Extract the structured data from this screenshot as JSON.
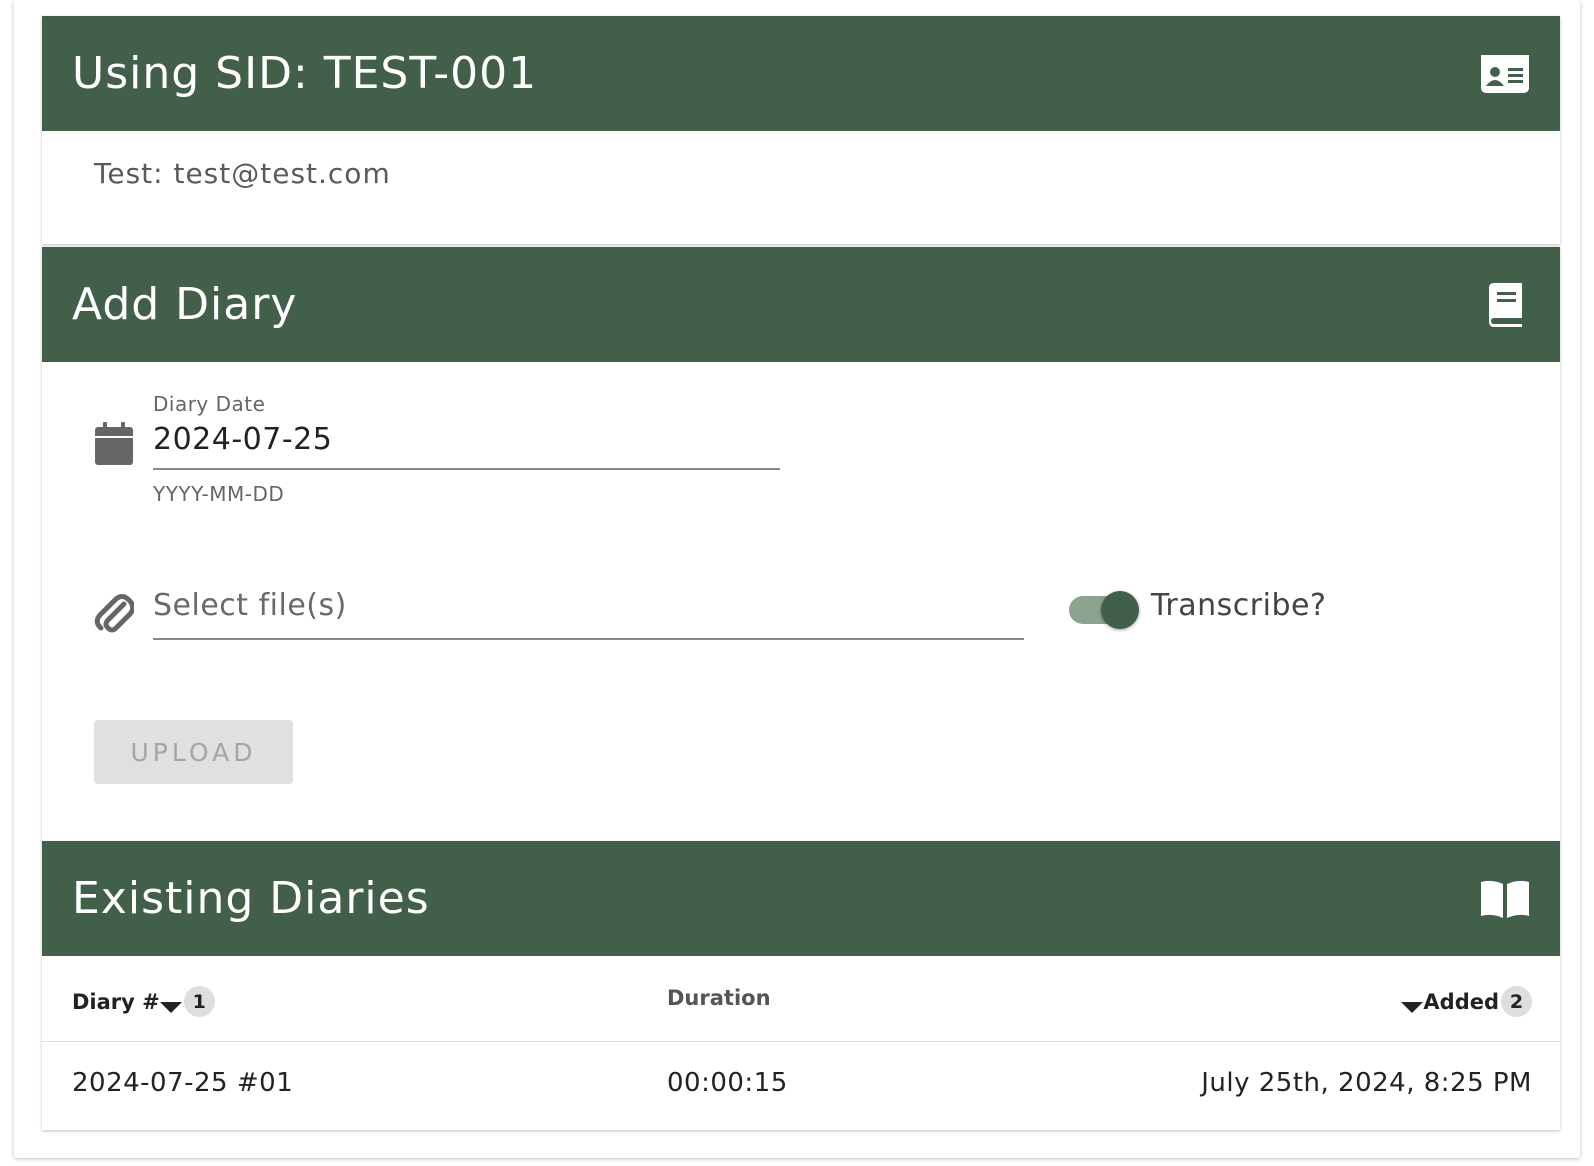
{
  "sid_card": {
    "title": "Using SID: TEST-001",
    "icon": "id-card-icon",
    "subject": "Test: test@test.com"
  },
  "add_diary": {
    "title": "Add Diary",
    "icon": "book-icon",
    "date_label": "Diary Date",
    "date_value": "2024-07-25",
    "date_hint": "YYYY-MM-DD",
    "file_placeholder": "Select file(s)",
    "transcribe_label": "Transcribe?",
    "transcribe_on": true,
    "upload_label": "UPLOAD"
  },
  "existing": {
    "title": "Existing Diaries",
    "icon": "book-open-icon",
    "columns": {
      "diary": "Diary #",
      "diary_sort_order": "1",
      "duration": "Duration",
      "added": "Added",
      "added_sort_order": "2"
    },
    "rows": [
      {
        "diary": "2024-07-25 #01",
        "duration": "00:00:15",
        "added": "July 25th, 2024, 8:25 PM"
      }
    ]
  },
  "colors": {
    "header_bg": "#425f4a",
    "toggle_track": "#8ba38f",
    "disabled_button": "#e0e0e0"
  }
}
